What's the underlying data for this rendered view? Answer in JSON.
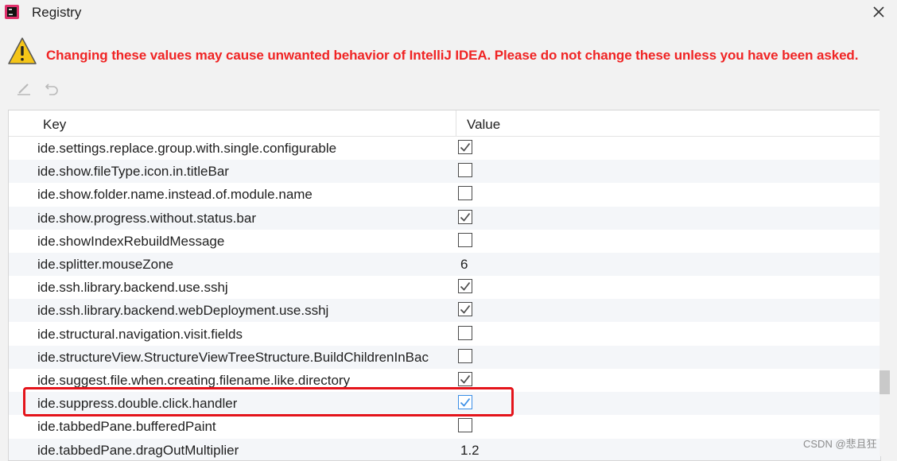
{
  "window": {
    "title": "Registry"
  },
  "warning": {
    "text": "Changing these values may cause unwanted behavior of IntelliJ IDEA. Please do not change these unless you have been asked."
  },
  "toolbar": {
    "edit_icon": "edit-icon",
    "revert_icon": "revert-icon"
  },
  "table": {
    "columns": [
      "Key",
      "Value"
    ],
    "rows": [
      {
        "key": "ide.settings.replace.group.with.single.configurable",
        "type": "checkbox",
        "value": true
      },
      {
        "key": "ide.show.fileType.icon.in.titleBar",
        "type": "checkbox",
        "value": false
      },
      {
        "key": "ide.show.folder.name.instead.of.module.name",
        "type": "checkbox",
        "value": false
      },
      {
        "key": "ide.show.progress.without.status.bar",
        "type": "checkbox",
        "value": true
      },
      {
        "key": "ide.showIndexRebuildMessage",
        "type": "checkbox",
        "value": false
      },
      {
        "key": "ide.splitter.mouseZone",
        "type": "text",
        "value": "6"
      },
      {
        "key": "ide.ssh.library.backend.use.sshj",
        "type": "checkbox",
        "value": true
      },
      {
        "key": "ide.ssh.library.backend.webDeployment.use.sshj",
        "type": "checkbox",
        "value": true
      },
      {
        "key": "ide.structural.navigation.visit.fields",
        "type": "checkbox",
        "value": false
      },
      {
        "key": "ide.structureView.StructureViewTreeStructure.BuildChildrenInBac",
        "type": "checkbox",
        "value": false
      },
      {
        "key": "ide.suggest.file.when.creating.filename.like.directory",
        "type": "checkbox",
        "value": true
      },
      {
        "key": "ide.suppress.double.click.handler",
        "type": "checkbox",
        "value": true,
        "highlighted": true
      },
      {
        "key": "ide.tabbedPane.bufferedPaint",
        "type": "checkbox",
        "value": false
      },
      {
        "key": "ide.tabbedPane.dragOutMultiplier",
        "type": "text",
        "value": "1.2"
      }
    ]
  },
  "colors": {
    "warning": "#f02424",
    "highlight_border": "#e4141b",
    "row_alt": "#f4f6f9"
  },
  "watermark": "CSDN @悲且狂"
}
